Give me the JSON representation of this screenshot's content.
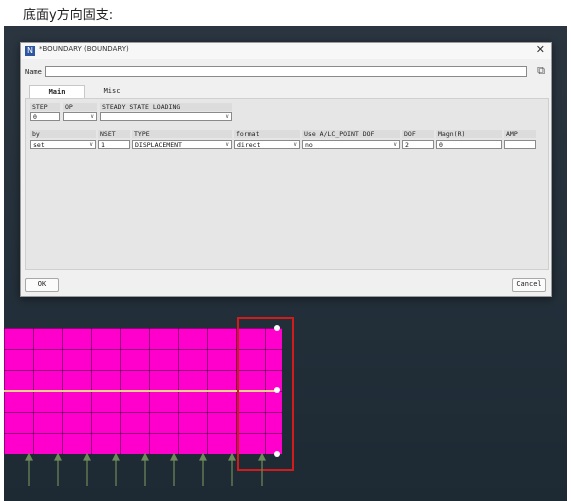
{
  "caption": "底面y方向固支:",
  "dialog": {
    "app_icon": "N",
    "title": "*BOUNDARY (BOUNDARY)",
    "close_glyph": "✕",
    "name_label": "Name",
    "name_value": "",
    "name_button_icon": "copy-icon",
    "tabs": [
      {
        "label": "Main",
        "active": true
      },
      {
        "label": "Misc",
        "active": false
      }
    ],
    "row1_headers": {
      "step": "STEP",
      "op": "OP",
      "loading": "STEADY STATE LOADING"
    },
    "row1_values": {
      "step": "0",
      "op": "",
      "loading": ""
    },
    "row2_headers": {
      "by": "by",
      "nset": "NSET",
      "type": "TYPE",
      "format": "format",
      "use": "Use A/LC_POINT DOF",
      "dof": "DOF",
      "magn": "Magn(R)",
      "amp": "AMP"
    },
    "row2_values": {
      "by": "set",
      "nset": "1",
      "type": "DISPLACEMENT",
      "format": "direct",
      "use": "no",
      "dof": "2",
      "magn": "0",
      "amp": ""
    },
    "ok_label": "OK",
    "cancel_label": "Cancel"
  },
  "viewport": {
    "mesh_color": "#ff00cc",
    "highlight_color": "#d21b1b",
    "arrow_color": "#6f8a5a"
  }
}
